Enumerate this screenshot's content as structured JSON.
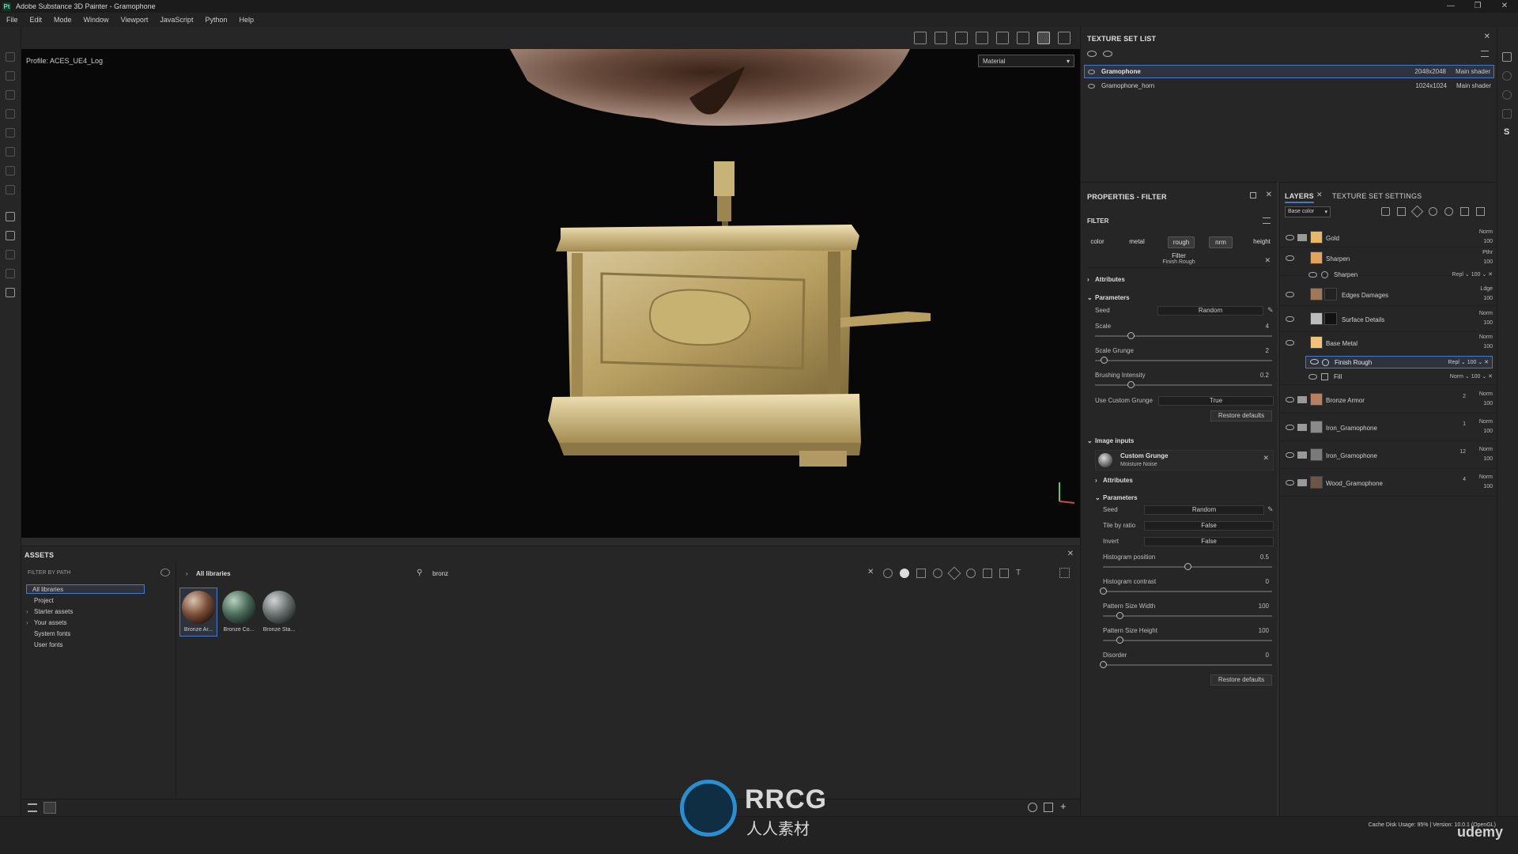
{
  "titlebar": {
    "title": "Adobe Substance 3D Painter - Gramophone",
    "logo": "Pt"
  },
  "menu": [
    "File",
    "Edit",
    "Mode",
    "Window",
    "Viewport",
    "JavaScript",
    "Python",
    "Help"
  ],
  "viewport": {
    "profile": "Profile: ACES_UE4_Log",
    "display_mode": "Material"
  },
  "texture_set_list": {
    "title": "TEXTURE SET LIST",
    "rows": [
      {
        "name": "Gramophone",
        "res": "2048x2048",
        "shader": "Main shader"
      },
      {
        "name": "Gramophone_horn",
        "res": "1024x1024",
        "shader": "Main shader"
      }
    ]
  },
  "properties": {
    "title": "PROPERTIES - FILTER",
    "filter_label": "FILTER",
    "channels": [
      "color",
      "metal",
      "rough",
      "nrm",
      "height"
    ],
    "filter_name": "Filter",
    "filter_sub": "Finish Rough",
    "attributes": "Attributes",
    "parameters": "Parameters",
    "params": [
      {
        "label": "Seed",
        "value": "Random"
      },
      {
        "label": "Scale",
        "value": "4",
        "level": 0.2
      },
      {
        "label": "Scale Grunge",
        "value": "2",
        "level": 0.05
      },
      {
        "label": "Brushing Intensity",
        "value": "0.2",
        "level": 0.2
      },
      {
        "label": "Use Custom Grunge",
        "value": "True"
      }
    ],
    "restore": "Restore defaults",
    "image_inputs": "Image inputs",
    "grunge_name": "Custom Grunge",
    "grunge_sub": "Moisture Noise",
    "attributes2": "Attributes",
    "parameters2": "Parameters",
    "params2": [
      {
        "label": "Seed",
        "value": "Random"
      },
      {
        "label": "Tile by ratio",
        "value": "False"
      },
      {
        "label": "Invert",
        "value": "False"
      },
      {
        "label": "Histogram position",
        "value": "0.5",
        "level": 0.5
      },
      {
        "label": "Histogram contrast",
        "value": "0",
        "level": 0.0
      },
      {
        "label": "Pattern Size Width",
        "value": "100",
        "level": 0.1
      },
      {
        "label": "Pattern Size Height",
        "value": "100",
        "level": 0.1
      },
      {
        "label": "Disorder",
        "value": "0",
        "level": 0.0
      }
    ],
    "restore2": "Restore defaults"
  },
  "layers_panel": {
    "tab_layers": "LAYERS",
    "tab_tss": "TEXTURE SET SETTINGS",
    "channel": "Base color",
    "rows": [
      {
        "name": "Gold",
        "blend": "Norm",
        "opacity": "100",
        "kind": "folder",
        "color": "#e7b86a"
      },
      {
        "name": "Sharpen",
        "blend": "Pthr",
        "opacity": "100",
        "kind": "fill",
        "color": "#e2a45c"
      },
      {
        "name": "Sharpen",
        "blend": "Repl",
        "opacity": "100",
        "kind": "effect"
      },
      {
        "name": "Edges Damages",
        "blend": "Ldge",
        "opacity": "100",
        "kind": "fill",
        "color": "#a07858"
      },
      {
        "name": "Surface Details",
        "blend": "Norm",
        "opacity": "100",
        "kind": "fill",
        "color": "#bdbdbd"
      },
      {
        "name": "Base Metal",
        "blend": "Norm",
        "opacity": "100",
        "kind": "fill",
        "color": "#f2c27a"
      },
      {
        "name": "Finish Rough",
        "blend": "Repl",
        "opacity": "100",
        "kind": "effect-selected"
      },
      {
        "name": "Fill",
        "blend": "Norm",
        "opacity": "100",
        "kind": "effect"
      },
      {
        "name": "Bronze Armor",
        "blend": "Norm",
        "opacity": "100",
        "count": "2",
        "kind": "folder",
        "color": "#b88060"
      },
      {
        "name": "Iron_Gramophone",
        "blend": "Norm",
        "opacity": "100",
        "count": "1",
        "kind": "folder",
        "color": "#8a8a8a"
      },
      {
        "name": "Iron_Gramophone",
        "blend": "Norm",
        "opacity": "100",
        "count": "12",
        "kind": "folder",
        "color": "#7a7a7a"
      },
      {
        "name": "Wood_Gramophone",
        "blend": "Norm",
        "opacity": "100",
        "count": "4",
        "kind": "folder",
        "color": "#6a5548"
      }
    ]
  },
  "assets": {
    "title": "ASSETS",
    "filter_by_path": "FILTER BY PATH",
    "breadcrumb": "All libraries",
    "search_value": "bronz",
    "tree": [
      "All libraries",
      "Project",
      "Starter assets",
      "Your assets",
      "System fonts",
      "User fonts"
    ],
    "items": [
      {
        "label": "Bronze Ar...",
        "color": "#5a3a2a"
      },
      {
        "label": "Bronze Co...",
        "color": "#4a6a5a"
      },
      {
        "label": "Bronze Sta...",
        "color": "#6a7070"
      }
    ]
  },
  "status": {
    "text": "Cache Disk Usage:   95% | Version: 10.0.1 (OpenGL)"
  },
  "overlays": {
    "watermark": "RRCG",
    "watermark_sub": "人人素材",
    "udemy": "udemy"
  }
}
